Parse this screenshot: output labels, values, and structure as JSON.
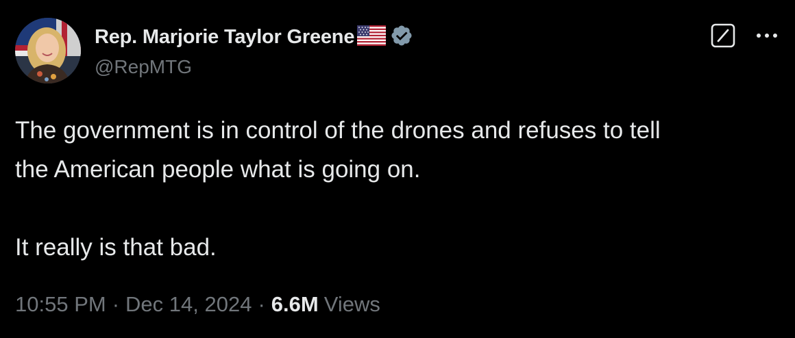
{
  "author": {
    "display_name": "Rep. Marjorie Taylor Greene",
    "handle": "@RepMTG",
    "badge_icon": "verified-badge-icon",
    "flag_icon": "us-flag-icon"
  },
  "toolbar": {
    "grok_icon": "grok-icon",
    "more_icon": "more-icon"
  },
  "tweet": {
    "line1": "The government is in control of the drones and refuses to tell",
    "line2": "the American people what is going on.",
    "line3": "It really is that bad."
  },
  "meta": {
    "time": "10:55 PM",
    "separator": "·",
    "date": "Dec 14, 2024",
    "views_count": "6.6M",
    "views_label": "Views"
  },
  "colors": {
    "background": "#000000",
    "text_primary": "#e7e9ea",
    "text_secondary": "#71767b",
    "verified_badge": "#829aab"
  }
}
